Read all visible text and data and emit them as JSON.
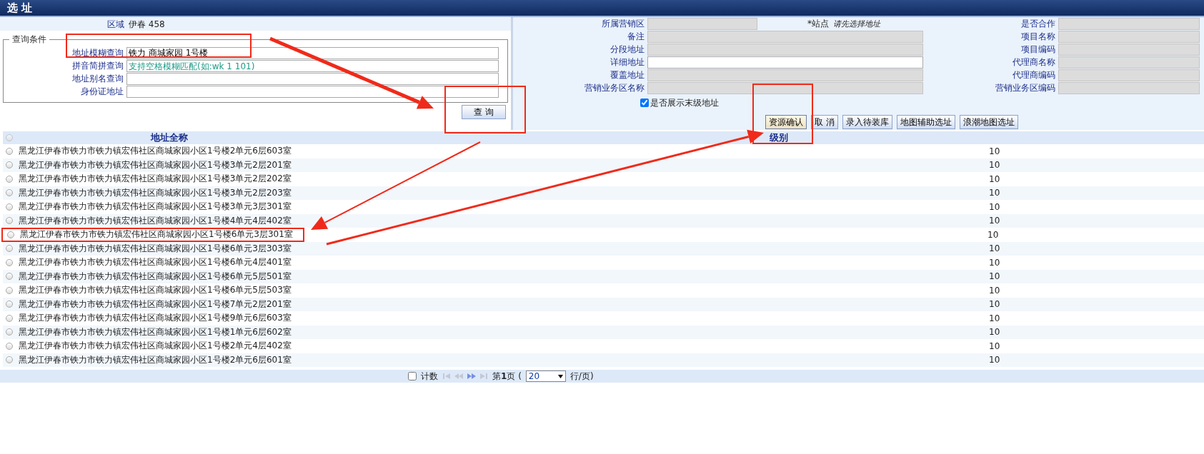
{
  "window": {
    "title": "选 址"
  },
  "region": {
    "label": "区域",
    "value": "伊春 458"
  },
  "query_conditions": {
    "legend": "查询条件",
    "fields": [
      {
        "label": "地址模糊查询",
        "value": "铁力 商城家园 1号楼"
      },
      {
        "label": "拼音简拼查询",
        "placeholder": "支持空格模糊匹配(如:wk 1 101)"
      },
      {
        "label": "地址别名查询"
      },
      {
        "label": "身份证地址"
      }
    ],
    "button": "查 询"
  },
  "details": {
    "station": {
      "label": "*站点",
      "hint": "请先选择地址"
    },
    "left_fields": [
      {
        "label": "所属营销区",
        "disabled": true
      },
      {
        "label": "备注",
        "disabled": true
      },
      {
        "label": "分段地址",
        "disabled": true
      },
      {
        "label": "详细地址",
        "disabled": false
      },
      {
        "label": "覆盖地址",
        "disabled": true
      },
      {
        "label": "营销业务区名称",
        "disabled": true
      }
    ],
    "right_fields": [
      {
        "label": "是否合作",
        "disabled": true
      },
      {
        "label": "项目名称",
        "disabled": true
      },
      {
        "label": "项目编码",
        "disabled": true
      },
      {
        "label": "代理商名称",
        "disabled": true
      },
      {
        "label": "代理商编码",
        "disabled": true
      },
      {
        "label": "营销业务区编码",
        "disabled": true
      }
    ],
    "show_last_level": {
      "label": "是否展示末级地址",
      "checked": true
    }
  },
  "actions": [
    {
      "label": "资源确认",
      "focused": true
    },
    {
      "label": "取 消",
      "focused": false
    },
    {
      "label": "录入待装库",
      "focused": false
    },
    {
      "label": "地图辅助选址",
      "focused": false
    },
    {
      "label": "浪潮地图选址",
      "focused": false
    }
  ],
  "table": {
    "columns": [
      "地址全称",
      "级别"
    ],
    "rows": [
      {
        "selected": false,
        "cells": [
          "黑龙江伊春市铁力市铁力镇宏伟社区商城家园小区1号楼2单元6层603室",
          "10"
        ]
      },
      {
        "selected": false,
        "cells": [
          "黑龙江伊春市铁力市铁力镇宏伟社区商城家园小区1号楼3单元2层201室",
          "10"
        ]
      },
      {
        "selected": false,
        "cells": [
          "黑龙江伊春市铁力市铁力镇宏伟社区商城家园小区1号楼3单元2层202室",
          "10"
        ]
      },
      {
        "selected": false,
        "cells": [
          "黑龙江伊春市铁力市铁力镇宏伟社区商城家园小区1号楼3单元2层203室",
          "10"
        ]
      },
      {
        "selected": false,
        "cells": [
          "黑龙江伊春市铁力市铁力镇宏伟社区商城家园小区1号楼3单元3层301室",
          "10"
        ]
      },
      {
        "selected": false,
        "cells": [
          "黑龙江伊春市铁力市铁力镇宏伟社区商城家园小区1号楼4单元4层402室",
          "10"
        ]
      },
      {
        "selected": false,
        "highlighted": true,
        "cells": [
          "黑龙江伊春市铁力市铁力镇宏伟社区商城家园小区1号楼6单元3层301室",
          "10"
        ]
      },
      {
        "selected": false,
        "cells": [
          "黑龙江伊春市铁力市铁力镇宏伟社区商城家园小区1号楼6单元3层303室",
          "10"
        ]
      },
      {
        "selected": false,
        "cells": [
          "黑龙江伊春市铁力市铁力镇宏伟社区商城家园小区1号楼6单元4层401室",
          "10"
        ]
      },
      {
        "selected": false,
        "cells": [
          "黑龙江伊春市铁力市铁力镇宏伟社区商城家园小区1号楼6单元5层501室",
          "10"
        ]
      },
      {
        "selected": false,
        "cells": [
          "黑龙江伊春市铁力市铁力镇宏伟社区商城家园小区1号楼6单元5层503室",
          "10"
        ]
      },
      {
        "selected": false,
        "cells": [
          "黑龙江伊春市铁力市铁力镇宏伟社区商城家园小区1号楼7单元2层201室",
          "10"
        ]
      },
      {
        "selected": false,
        "cells": [
          "黑龙江伊春市铁力市铁力镇宏伟社区商城家园小区1号楼9单元6层603室",
          "10"
        ]
      },
      {
        "selected": false,
        "cells": [
          "黑龙江伊春市铁力市铁力镇宏伟社区商城家园小区1号楼1单元6层602室",
          "10"
        ]
      },
      {
        "selected": false,
        "cells": [
          "黑龙江伊春市铁力市铁力镇宏伟社区商城家园小区1号楼2单元4层402室",
          "10"
        ]
      },
      {
        "selected": false,
        "cells": [
          "黑龙江伊春市铁力市铁力镇宏伟社区商城家园小区1号楼2单元6层601室",
          "10"
        ]
      }
    ]
  },
  "pager": {
    "count": {
      "label": "计数",
      "checked": false
    },
    "page": "第**1**页 (",
    "page_size": "20",
    "per_page": "行/页)"
  }
}
